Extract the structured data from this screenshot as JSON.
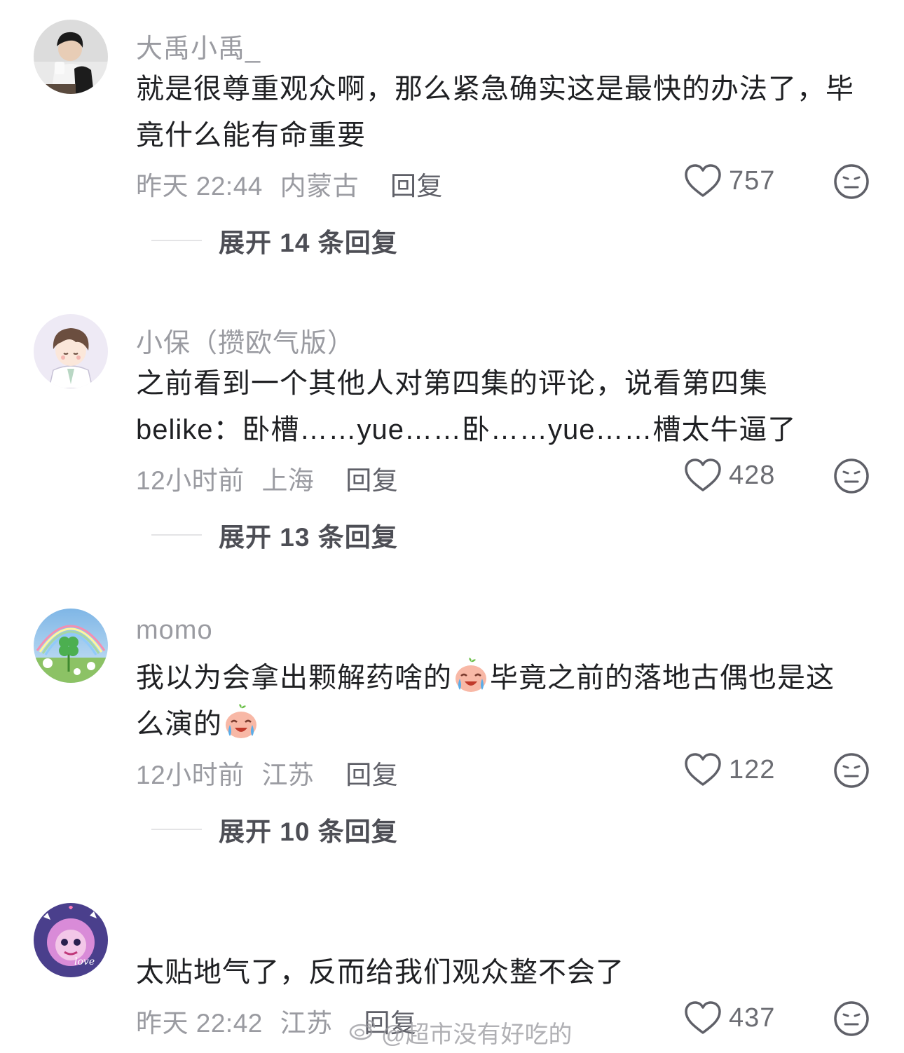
{
  "colors": {
    "secondary_text": "#9a9ba1",
    "body_text": "#1f2023",
    "reply_text": "#5f6068",
    "expand_text": "#4d4e55"
  },
  "comments": [
    {
      "username": "大禹小禹_",
      "lines": [
        "就是很尊重观众啊，那么紧急确实这是最快的办法了，毕",
        "竟什么能有命重要"
      ],
      "time": "昨天 22:44",
      "location": "内蒙古",
      "reply": "回复",
      "likes": "757",
      "expand": "展开 14 条回复"
    },
    {
      "username": "小保（攒欧气版）",
      "lines": [
        "之前看到一个其他人对第四集的评论，说看第四集",
        "belike：卧槽……yue……卧……yue……槽太牛逼了"
      ],
      "time": "12小时前",
      "location": "上海",
      "reply": "回复",
      "likes": "428",
      "expand": "展开 13 条回复"
    },
    {
      "username": "momo",
      "line1_part1": "我以为会拿出颗解药啥的",
      "line1_part2": "毕竟之前的落地古偶也是这",
      "line2_part1": "么演的",
      "emoji_name": "crying-laughing-emoji",
      "time": "12小时前",
      "location": "江苏",
      "reply": "回复",
      "likes": "122",
      "expand": "展开 10 条回复"
    },
    {
      "username": "",
      "lines": [
        "太贴地气了，反而给我们观众整不会了"
      ],
      "time": "昨天 22:42",
      "location": "江苏",
      "reply": "回复",
      "likes": "437",
      "avatar_text": "love"
    }
  ],
  "icons": {
    "like": "heart-outline-icon",
    "dislike": "neutral-face-icon"
  },
  "watermark": "@超市没有好吃的"
}
